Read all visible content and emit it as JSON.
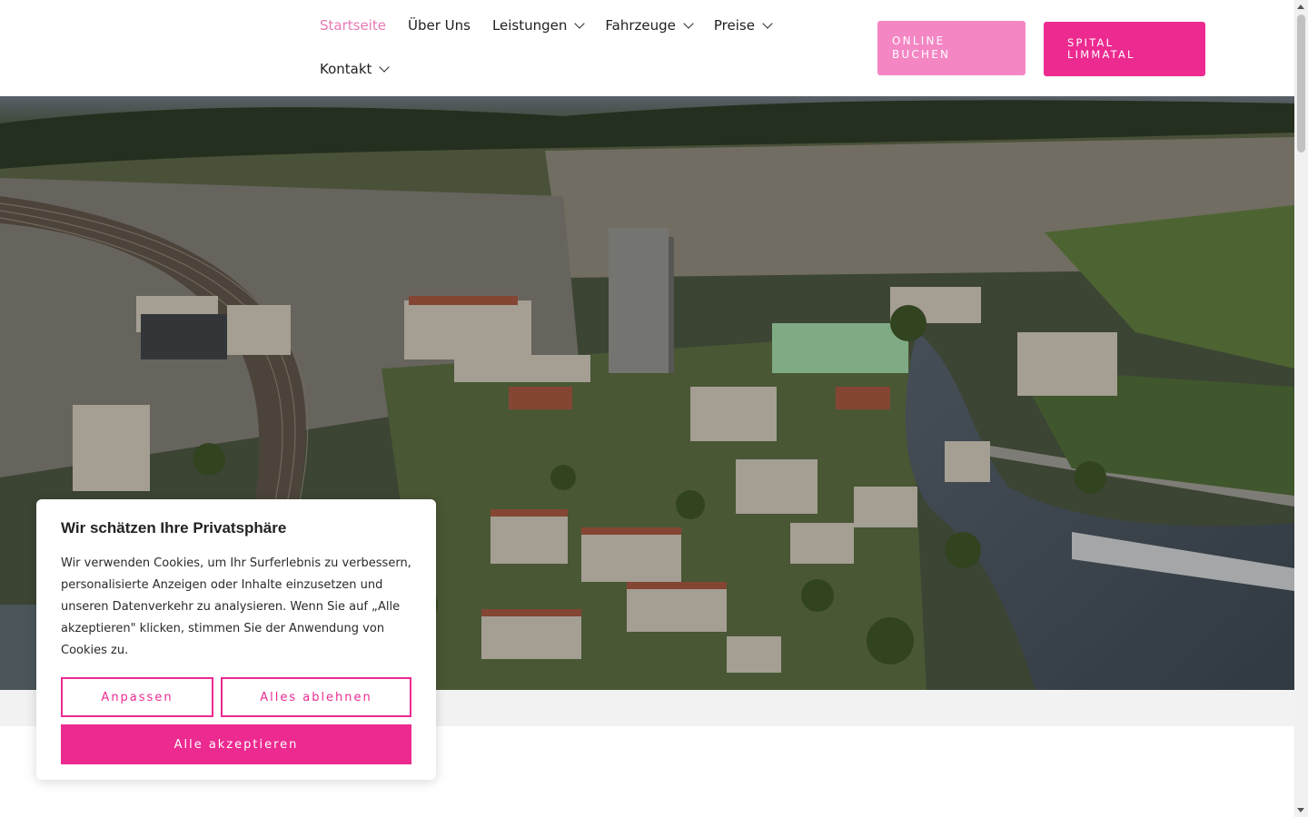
{
  "colors": {
    "accent": "#ec2a90",
    "accent_light": "#f486c4",
    "nav_active": "#e878b4"
  },
  "nav": {
    "items": [
      {
        "label": "Startseite",
        "active": true,
        "dropdown": false
      },
      {
        "label": "Über Uns",
        "active": false,
        "dropdown": false
      },
      {
        "label": "Leistungen",
        "active": false,
        "dropdown": true
      },
      {
        "label": "Fahrzeuge",
        "active": false,
        "dropdown": true
      },
      {
        "label": "Preise",
        "active": false,
        "dropdown": true
      },
      {
        "label": "Kontakt",
        "active": false,
        "dropdown": true
      }
    ]
  },
  "header_buttons": {
    "online": {
      "line1": "ONLINE",
      "line2": "BUCHEN"
    },
    "spital": {
      "line1": "SPITAL",
      "line2": "LIMMATAL"
    }
  },
  "hero": {
    "image": "aerial-city-river-photo"
  },
  "cookie": {
    "title": "Wir schätzen Ihre Privatsphäre",
    "text": "Wir verwenden Cookies, um Ihr Surferlebnis zu verbessern, personalisierte Anzeigen oder Inhalte einzusetzen und unseren Datenverkehr zu analysieren. Wenn Sie auf „Alle akzeptieren\" klicken, stimmen Sie der Anwendung von Cookies zu.",
    "customize": "Anpassen",
    "reject": "Alles ablehnen",
    "accept": "Alle akzeptieren"
  }
}
